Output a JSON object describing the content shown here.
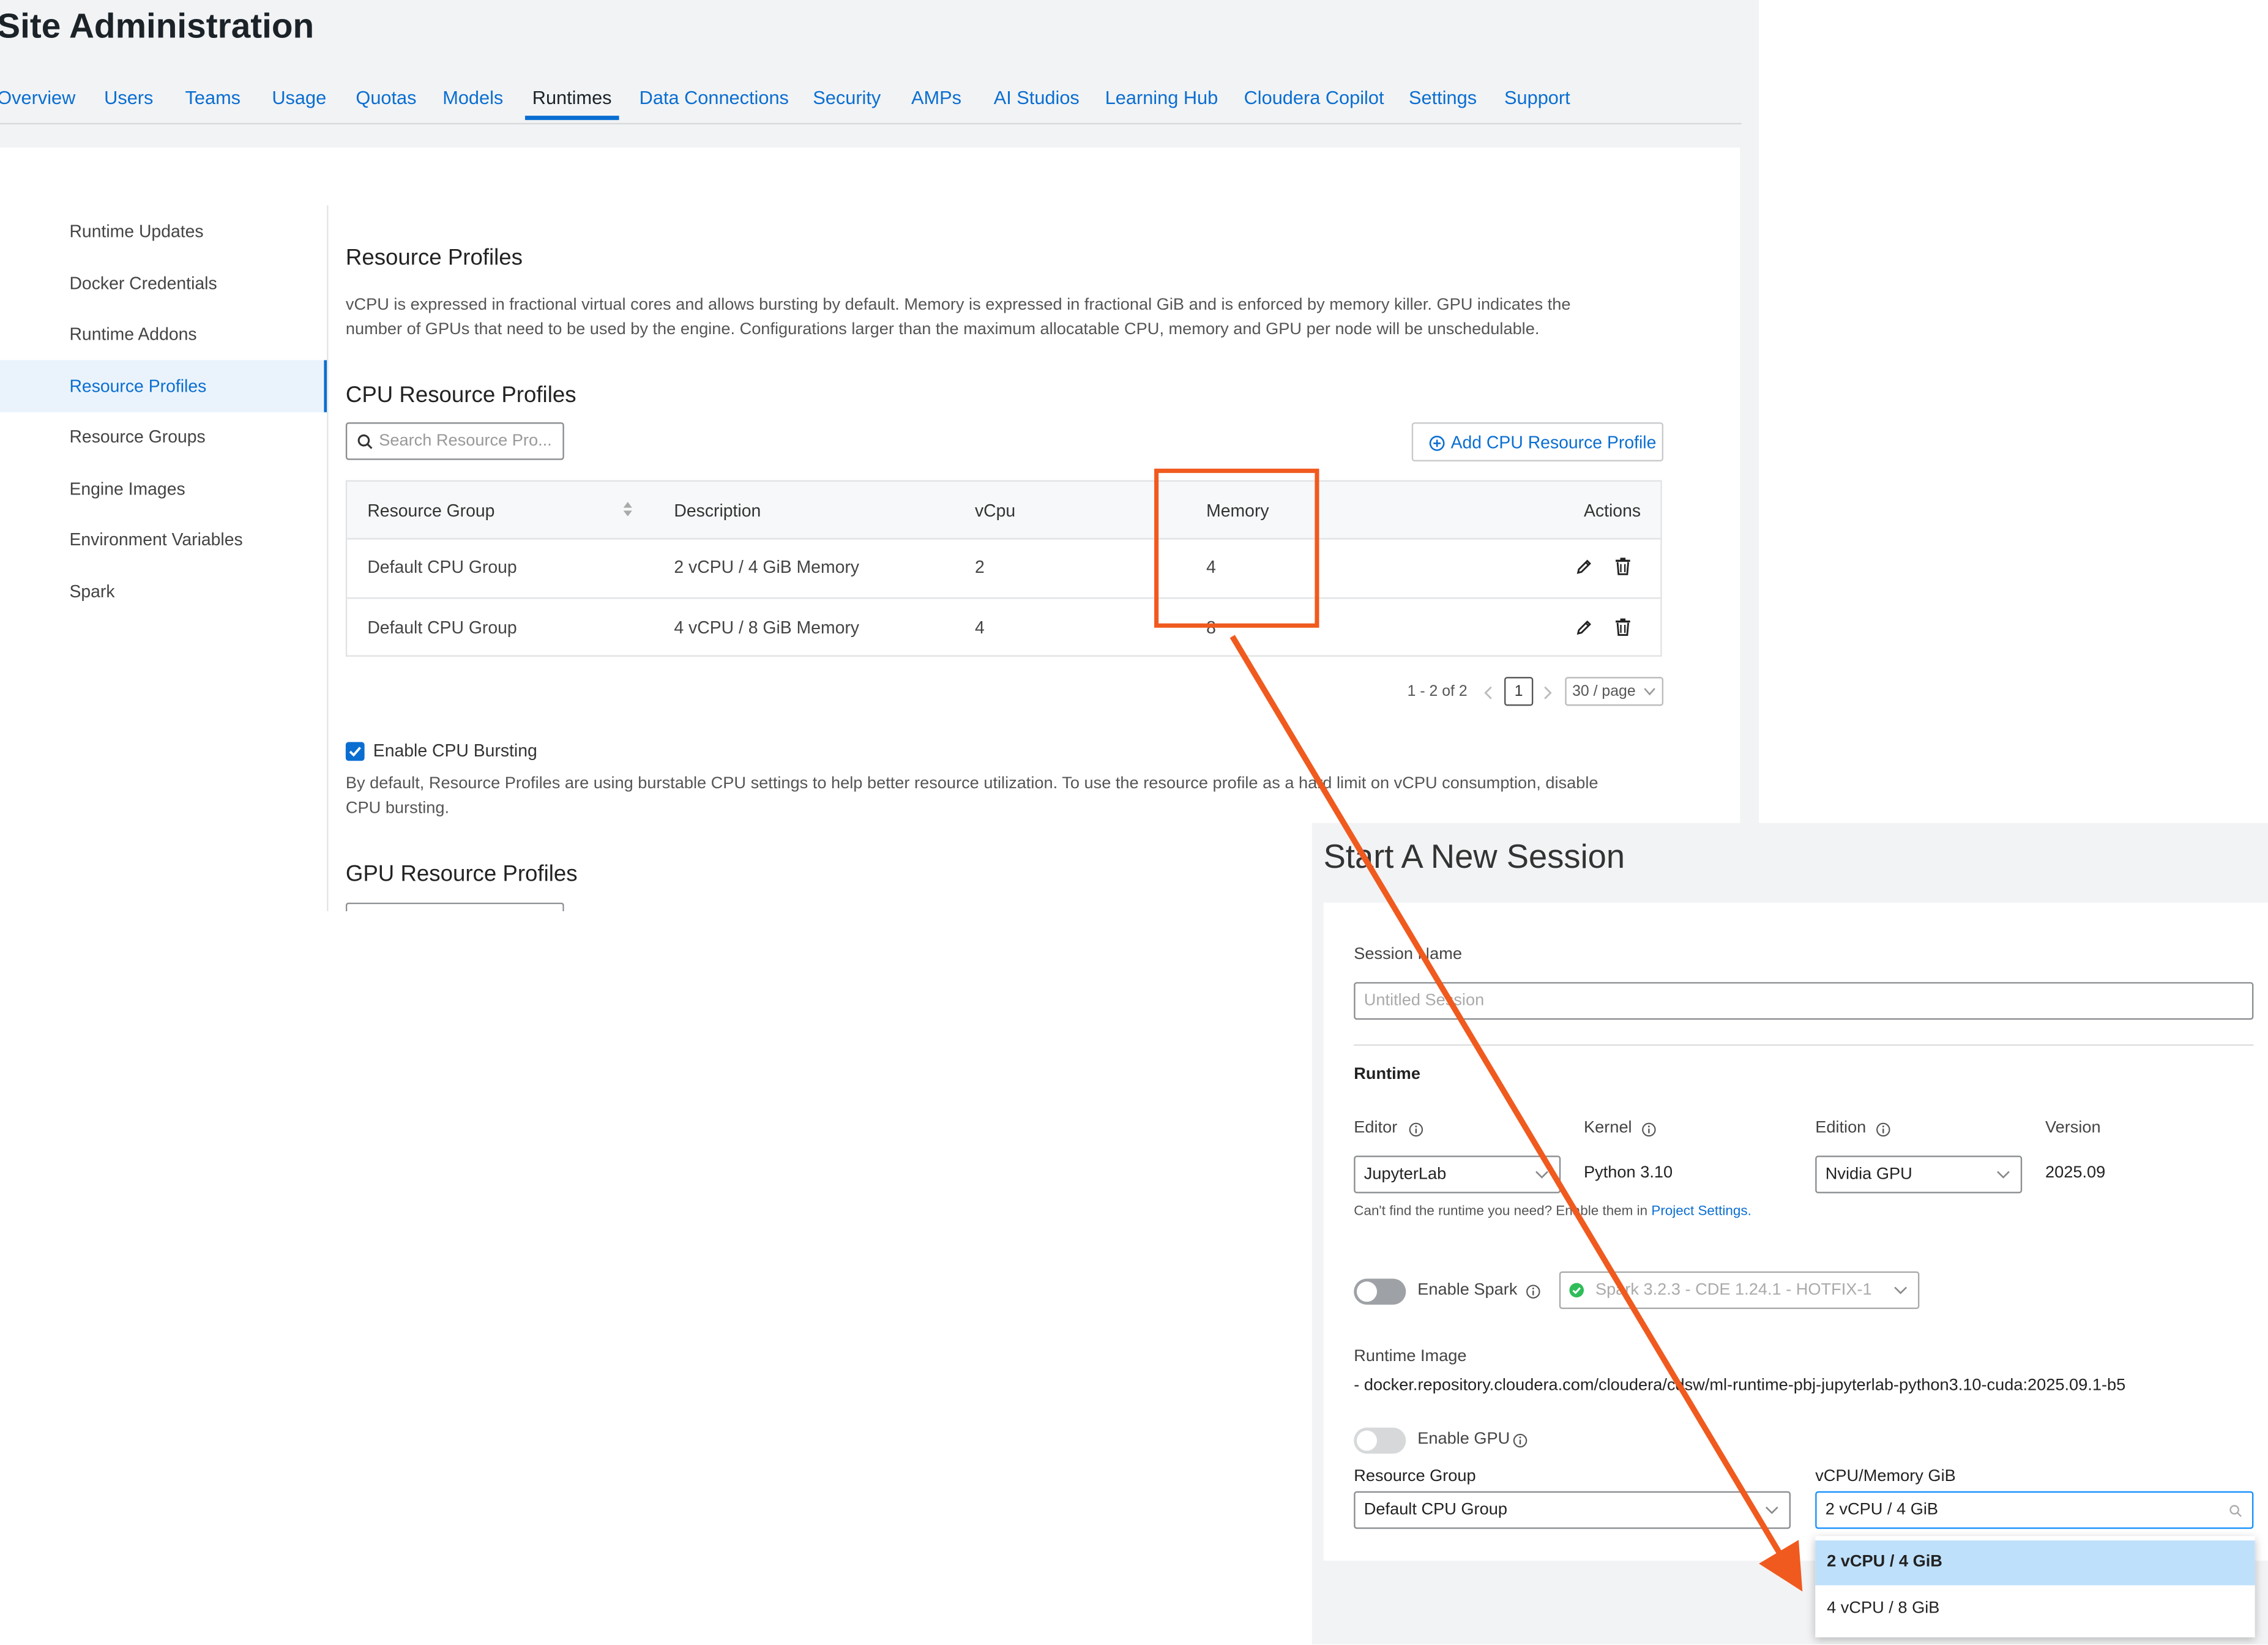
{
  "admin": {
    "title": "Site Administration",
    "nav_tabs": [
      "Overview",
      "Users",
      "Teams",
      "Usage",
      "Quotas",
      "Models",
      "Runtimes",
      "Data Connections",
      "Security",
      "AMPs",
      "AI Studios",
      "Learning Hub",
      "Cloudera Copilot",
      "Settings",
      "Support"
    ],
    "active_tab": "Runtimes",
    "sidebar": [
      "Runtime Updates",
      "Docker Credentials",
      "Runtime Addons",
      "Resource Profiles",
      "Resource Groups",
      "Engine Images",
      "Environment Variables",
      "Spark"
    ],
    "sidebar_active": "Resource Profiles",
    "resource_profiles": {
      "heading": "Resource Profiles",
      "description_line1": "vCPU is expressed in fractional virtual cores and allows bursting by default. Memory is expressed in fractional GiB and is enforced by memory killer. GPU indicates the",
      "description_line2": "number of GPUs that need to be used by the engine. Configurations larger than the maximum allocatable CPU, memory and GPU per node will be unschedulable."
    },
    "cpu_profiles": {
      "heading": "CPU Resource Profiles",
      "search_placeholder": "Search Resource Pro...",
      "add_button": "Add CPU Resource Profile",
      "columns": [
        "Resource Group",
        "Description",
        "vCpu",
        "Memory",
        "Actions"
      ],
      "rows": [
        {
          "group": "Default CPU Group",
          "description": "2 vCPU / 4 GiB Memory",
          "vcpu": "2",
          "memory": "4"
        },
        {
          "group": "Default CPU Group",
          "description": "4 vCPU / 8 GiB Memory",
          "vcpu": "4",
          "memory": "8"
        }
      ],
      "pagination": {
        "range": "1 - 2 of 2",
        "page": "1",
        "per_page": "30 / page"
      }
    },
    "bursting": {
      "label": "Enable CPU Bursting",
      "checked": true,
      "description_line1": "By default, Resource Profiles are using burstable CPU settings to help better resource utilization. To use the resource profile as a hard limit on vCPU consumption, disable",
      "description_line2": "CPU bursting."
    },
    "gpu_profiles": {
      "heading": "GPU Resource Profiles"
    }
  },
  "session": {
    "title": "Start A New Session",
    "session_name_label": "Session Name",
    "session_name_placeholder": "Untitled Session",
    "runtime_heading": "Runtime",
    "editor_label": "Editor",
    "editor_value": "JupyterLab",
    "kernel_label": "Kernel",
    "kernel_value": "Python 3.10",
    "edition_label": "Edition",
    "edition_value": "Nvidia GPU",
    "version_label": "Version",
    "version_value": "2025.09",
    "help_text": "Can't find the runtime you need? Enable them in",
    "help_link": "Project Settings.",
    "spark_label": "Enable Spark",
    "spark_value": "Spark 3.2.3 - CDE 1.24.1 - HOTFIX-1",
    "runtime_image_label": "Runtime Image",
    "runtime_image_value": "- docker.repository.cloudera.com/cloudera/cdsw/ml-runtime-pbj-jupyterlab-python3.10-cuda:2025.09.1-b5",
    "gpu_label": "Enable GPU",
    "resource_group_label": "Resource Group",
    "resource_group_value": "Default CPU Group",
    "vcpu_memory_label": "vCPU/Memory GiB",
    "vcpu_memory_placeholder": "2 vCPU / 4 GiB",
    "vcpu_memory_options": [
      "2 vCPU / 4 GiB",
      "4 vCPU / 8 GiB"
    ],
    "vcpu_memory_highlighted": "2 vCPU / 4 GiB"
  },
  "colors": {
    "accent": "#0a6ed1",
    "annotation": "#f05a1e",
    "highlight": "#bfe0fb"
  }
}
